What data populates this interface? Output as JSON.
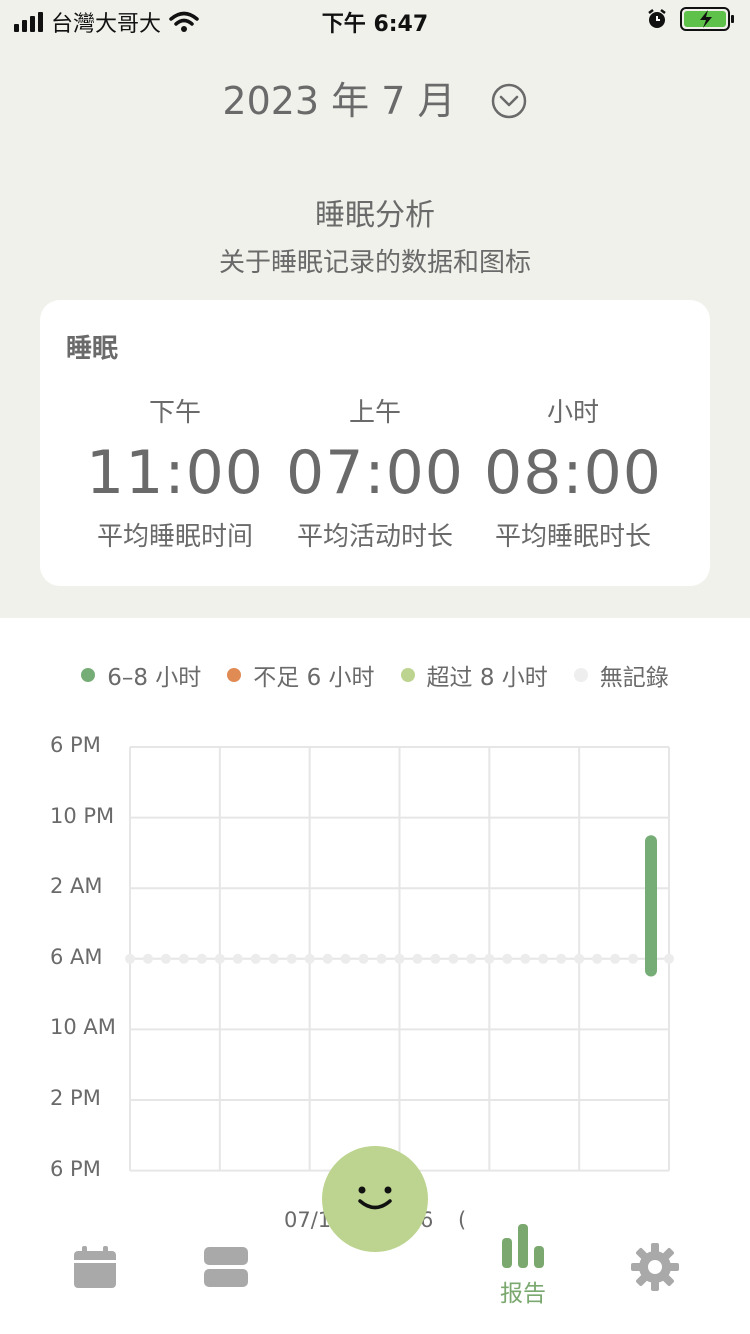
{
  "status_bar": {
    "carrier": "台灣大哥大",
    "time": "下午 6:47"
  },
  "header": {
    "month": "2023 年 7 月"
  },
  "section": {
    "title": "睡眠分析",
    "subtitle": "关于睡眠记录的数据和图标"
  },
  "sleep_card": {
    "title": "睡眠",
    "stats": [
      {
        "label": "下午",
        "value": "11:00",
        "caption": "平均睡眠时间"
      },
      {
        "label": "上午",
        "value": "07:00",
        "caption": "平均活动时长"
      },
      {
        "label": "小时",
        "value": "08:00",
        "caption": "平均睡眠时长"
      }
    ]
  },
  "legend": [
    {
      "label": "6–8 小时",
      "color": "#76ad76"
    },
    {
      "label": "不足 6 小时",
      "color": "#e08a54"
    },
    {
      "label": "超过 8 小时",
      "color": "#bcd48f"
    },
    {
      "label": "無記錄",
      "color": "#eeeeee"
    }
  ],
  "chart_data": {
    "type": "bar",
    "y_tick_labels": [
      "6 PM",
      "10 PM",
      "2 AM",
      "6 AM",
      "10 AM",
      "2 PM",
      "6 PM"
    ],
    "x_tick_labels_partial": [
      "07/1",
      "6",
      "("
    ],
    "no_record_level": "6 AM",
    "bars": [
      {
        "day_index": 30,
        "start": "11 PM",
        "end": "7 AM",
        "category": "6–8 小时",
        "color": "#76ad76"
      }
    ],
    "no_record_days": 31,
    "grid": true
  },
  "tabbar": {
    "active_label": "报告",
    "tabs": [
      "calendar",
      "list",
      "mood",
      "report",
      "settings"
    ]
  },
  "colors": {
    "accent": "#76ad76",
    "background_top": "#f1f1ec",
    "fab": "#bcd48f"
  }
}
